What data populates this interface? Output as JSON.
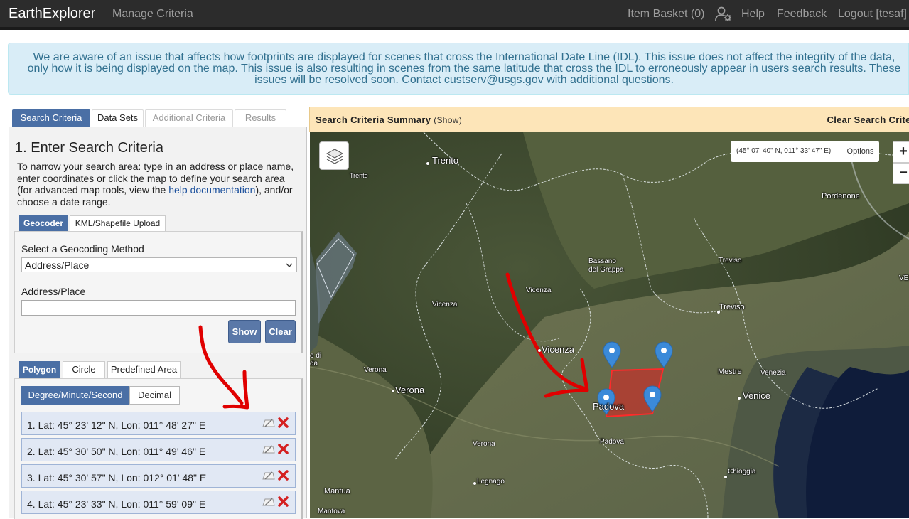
{
  "navbar": {
    "brand": "EarthExplorer",
    "manage_criteria": "Manage Criteria",
    "item_basket": "Item Basket (0)",
    "help": "Help",
    "feedback": "Feedback",
    "logout": "Logout [tesaf]"
  },
  "alert": {
    "message": "We are aware of an issue that affects how footprints are displayed for scenes that cross the International Date Line (IDL). This issue does not affect the integrity of the data, only how it is being displayed on the map. This issue is also resulting in scenes from the same latitude that cross the IDL to erroneously appear in users search results. These issues will be resolved soon. Contact custserv@usgs.gov with additional questions."
  },
  "tabs": [
    "Search Criteria",
    "Data Sets",
    "Additional Criteria",
    "Results"
  ],
  "search_panel": {
    "title": "1. Enter Search Criteria",
    "desc_before": "To narrow your search area: type in an address or place name, enter coordinates or click the map to define your search area (for advanced map tools, view the ",
    "desc_link": "help documentation",
    "desc_after": "), and/or choose a date range."
  },
  "geocoder": {
    "tabs": [
      "Geocoder",
      "KML/Shapefile Upload"
    ],
    "method_label": "Select a Geocoding Method",
    "method_value": "Address/Place",
    "address_label": "Address/Place",
    "address_value": "",
    "show_button": "Show",
    "clear_button": "Clear"
  },
  "area": {
    "tabs": [
      "Polygon",
      "Circle",
      "Predefined Area"
    ],
    "formats": [
      "Degree/Minute/Second",
      "Decimal"
    ],
    "coordinates": [
      "1.  Lat: 45° 23' 12\" N, Lon: 011° 48' 27\" E",
      "2.  Lat: 45° 30' 50\" N, Lon: 011° 49' 46\" E",
      "3.  Lat: 45° 30' 57\" N, Lon: 012° 01' 48\" E",
      "4.  Lat: 45° 23' 33\" N, Lon: 011° 59' 09\" E"
    ]
  },
  "map": {
    "summary_title": "Search Criteria Summary",
    "summary_show": "(Show)",
    "clear": "Clear Search Criter",
    "coordinates": "(45° 07' 40\" N, 011° 33' 47\" E)",
    "options": "Options",
    "zoom_in": "+",
    "zoom_out": "−",
    "places": {
      "trento": "Trento",
      "trento_small": "Trento",
      "pordenone": "Pordenone",
      "bassano": "Bassano\ndel Grappa",
      "treviso1": "Treviso",
      "treviso2": "Treviso",
      "vicenza1": "Vicenza",
      "vicenza2": "Vicenza",
      "vicenza3": "Vicenza",
      "verona1": "Verona",
      "verona2": "Verona",
      "verona3": "Verona",
      "mestre": "Mestre",
      "venezia": "Venezia",
      "venice": "Venice",
      "padova1": "Padova",
      "padova2": "Padova",
      "chioggia": "Chioggia",
      "legnago": "Legnago",
      "mantua": "Mantua",
      "mantova": "Mantova",
      "lake_a": "o di",
      "lake_b": "da",
      "ver": "VER"
    },
    "colors": {
      "polygon_fill": "#e02020",
      "marker": "#3b8ad9",
      "annotation_arrow": "#e00000"
    }
  }
}
